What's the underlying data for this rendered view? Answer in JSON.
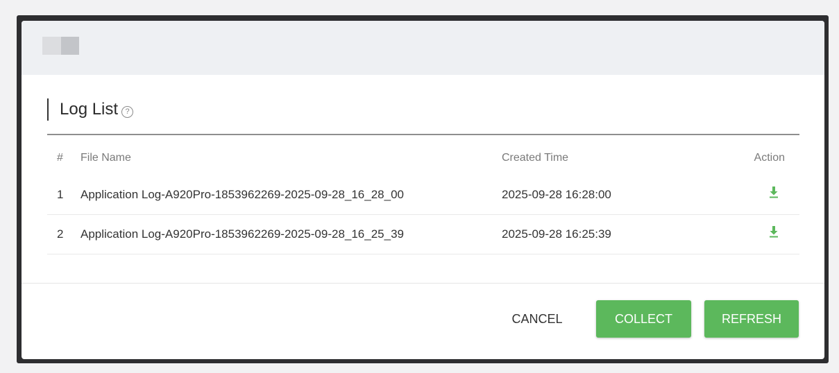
{
  "dialog": {
    "section_title": "Log List",
    "help_icon": "?"
  },
  "table": {
    "columns": {
      "num": "#",
      "file_name": "File Name",
      "created_time": "Created Time",
      "action": "Action"
    },
    "rows": [
      {
        "num": "1",
        "file_name": "Application Log-A920Pro-1853962269-2025-09-28_16_28_00",
        "created_time": "2025-09-28 16:28:00",
        "action_icon": "download-icon"
      },
      {
        "num": "2",
        "file_name": "Application Log-A920Pro-1853962269-2025-09-28_16_25_39",
        "created_time": "2025-09-28 16:25:39",
        "action_icon": "download-icon"
      }
    ]
  },
  "footer": {
    "cancel_label": "CANCEL",
    "collect_label": "COLLECT",
    "refresh_label": "REFRESH"
  },
  "colors": {
    "accent_green": "#5cb85c",
    "header_bg": "#eef0f3",
    "frame": "#2e2e30"
  }
}
